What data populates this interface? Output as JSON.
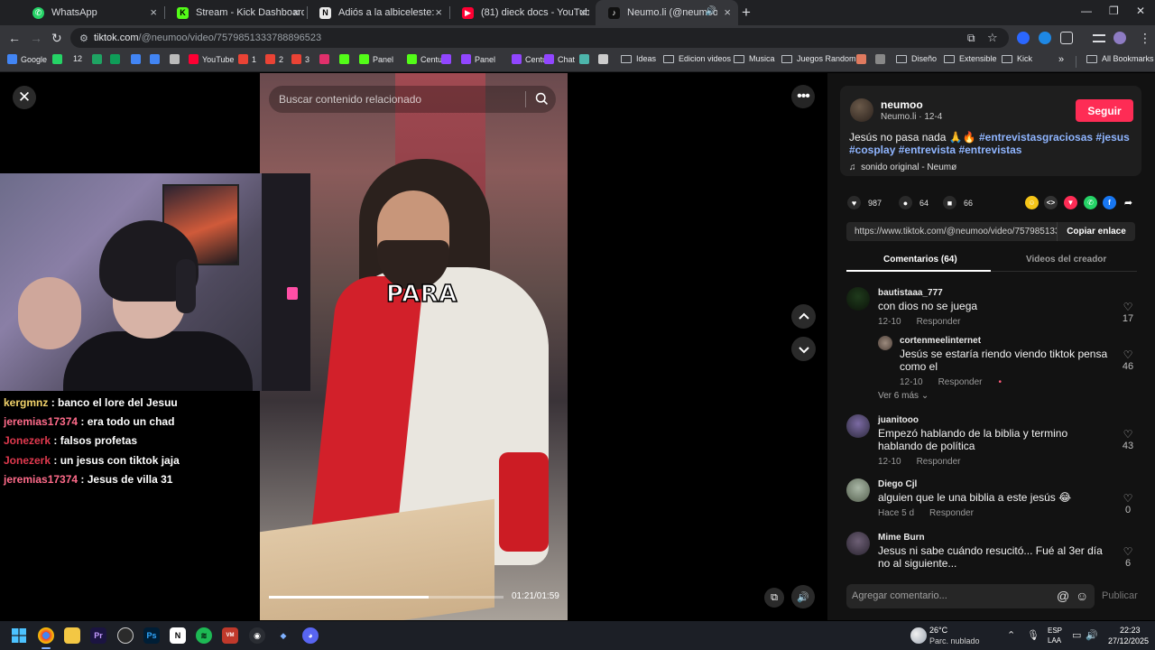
{
  "browser": {
    "tabs": [
      {
        "title": "WhatsApp",
        "icon": "whatsapp-icon",
        "color": "#25d366"
      },
      {
        "title": "Stream - Kick Dashboard",
        "icon": "kick-icon",
        "color": "#53fc18"
      },
      {
        "title": "Adiós a la albiceleste: Obligan a",
        "icon": "news-icon",
        "color": "#e9e9e9"
      },
      {
        "title": "(81) dieck docs - YouTube",
        "icon": "youtube-icon",
        "color": "#ff0033"
      },
      {
        "title": "Neumo.li (@neumoo) | TikT",
        "icon": "tiktok-icon",
        "color": "#111111"
      }
    ],
    "url_domain": "tiktok.com",
    "url_path": "/@neumoo/video/7579851333788896523",
    "bookmarks": [
      {
        "label": "Google",
        "kind": "google-icon",
        "color": "#4285f4"
      },
      {
        "label": "",
        "kind": "whatsapp-icon",
        "color": "#25d366"
      },
      {
        "label": "12",
        "kind": "count",
        "color": "#888888"
      },
      {
        "label": "",
        "kind": "drive-icon",
        "color": "#1fa463"
      },
      {
        "label": "",
        "kind": "sheets-icon",
        "color": "#0f9d58"
      },
      {
        "label": "",
        "kind": "docs-icon",
        "color": "#4285f4"
      },
      {
        "label": "",
        "kind": "calendar-icon",
        "color": "#4285f4"
      },
      {
        "label": "",
        "kind": "chatgpt-icon",
        "color": "#bbbbbb"
      },
      {
        "label": "YouTube",
        "kind": "youtube-icon",
        "color": "#ff0033"
      },
      {
        "label": "1",
        "kind": "gmail-icon",
        "color": "#ea4335"
      },
      {
        "label": "2",
        "kind": "gmail-icon",
        "color": "#ea4335"
      },
      {
        "label": "3",
        "kind": "gmail-icon",
        "color": "#ea4335"
      },
      {
        "label": "",
        "kind": "instagram-icon",
        "color": "#e1306c"
      },
      {
        "label": "",
        "kind": "kick-icon",
        "color": "#53fc18"
      },
      {
        "label": "Panel",
        "kind": "kick-icon",
        "color": "#53fc18"
      },
      {
        "label": "Centu",
        "kind": "kick-icon",
        "color": "#53fc18"
      },
      {
        "label": "",
        "kind": "twitch-icon",
        "color": "#9146ff"
      },
      {
        "label": "Panel",
        "kind": "twitch-icon",
        "color": "#9146ff"
      },
      {
        "label": "Centu",
        "kind": "twitch-icon",
        "color": "#9146ff"
      },
      {
        "label": "Chat",
        "kind": "twitch-icon",
        "color": "#9146ff"
      },
      {
        "label": "",
        "kind": "app-icon",
        "color": "#4db6ac"
      },
      {
        "label": "",
        "kind": "app-icon",
        "color": "#cccccc"
      },
      {
        "label": "Ideas",
        "kind": "folder",
        "color": ""
      },
      {
        "label": "Edicion videos",
        "kind": "folder",
        "color": ""
      },
      {
        "label": "Musica",
        "kind": "folder",
        "color": ""
      },
      {
        "label": "Juegos Random",
        "kind": "folder",
        "color": ""
      },
      {
        "label": "",
        "kind": "app-icon",
        "color": "#e07a5f"
      },
      {
        "label": "",
        "kind": "app-icon",
        "color": "#888888"
      },
      {
        "label": "Diseño",
        "kind": "folder",
        "color": ""
      },
      {
        "label": "Extensible",
        "kind": "folder",
        "color": ""
      },
      {
        "label": "Kick",
        "kind": "folder",
        "color": ""
      }
    ],
    "all_bookmarks": "All Bookmarks"
  },
  "video": {
    "search_placeholder": "Buscar contenido relacionado",
    "caption": "PARA",
    "time": "01:21/01:59",
    "progress_fraction": 0.68
  },
  "chat": [
    {
      "user": "kergmnz",
      "color": "#f2d36b",
      "message": "banco el lore del Jesuu"
    },
    {
      "user": "jeremias17374",
      "color": "#ff6b8a",
      "message": "era todo un chad"
    },
    {
      "user": "Jonezerk",
      "color": "#e0394e",
      "message": "falsos profetas"
    },
    {
      "user": "Jonezerk",
      "color": "#e0394e",
      "message": "un jesus con tiktok jaja"
    },
    {
      "user": "jeremias17374",
      "color": "#ff6b8a",
      "message": "Jesus de villa 31"
    }
  ],
  "creator": {
    "username": "neumoo",
    "subtitle": "Neumo.li · 12-4",
    "follow_label": "Seguir",
    "description_text": "Jesús no pasa nada 🙏🔥",
    "hashtags": [
      "#entrevistasgraciosas",
      "#jesus",
      "#cosplay",
      "#entrevista",
      "#entrevistas"
    ],
    "sound": "sonido original - Neumø"
  },
  "stats": {
    "likes": "987",
    "comments": "64",
    "saves": "66"
  },
  "share": {
    "url": "https://www.tiktok.com/@neumoo/video/7579851333788896523",
    "copy_label": "Copiar enlace"
  },
  "panel_tabs": {
    "comments": "Comentarios (64)",
    "creator_videos": "Videos del creador"
  },
  "comments": [
    {
      "user": "bautistaaa_777",
      "text": "con dios no se juega",
      "date": "12-10",
      "reply": "Responder",
      "likes": "17"
    },
    {
      "user": "cortenmeelinternet",
      "text": "Jesús se estaría riendo viendo tiktok pensa como el",
      "date": "12-10",
      "reply": "Responder",
      "likes": "46"
    },
    {
      "user": "juanitooo",
      "text": "Empezó hablando de la biblia y termino hablando de política",
      "date": "12-10",
      "reply": "Responder",
      "likes": "43"
    },
    {
      "user": "Diego Cjl",
      "text": "alguien que le una biblia a este jesús 😂",
      "date": "Hace 5 d",
      "reply": "Responder",
      "likes": "0"
    },
    {
      "user": "Mime Burn",
      "text": "Jesus ni sabe cuándo resucitó... Fué al 3er día no al siguiente...",
      "date": "",
      "reply": "",
      "likes": "6"
    }
  ],
  "see_more": "Ver 6 más",
  "add_comment_placeholder": "Agregar comentario...",
  "publish_label": "Publicar",
  "taskbar": {
    "weather_temp": "26°C",
    "weather_desc": "Parc. nublado",
    "lang_1": "ESP",
    "lang_2": "LAA",
    "time": "22:23",
    "date": "27/12/2025"
  }
}
